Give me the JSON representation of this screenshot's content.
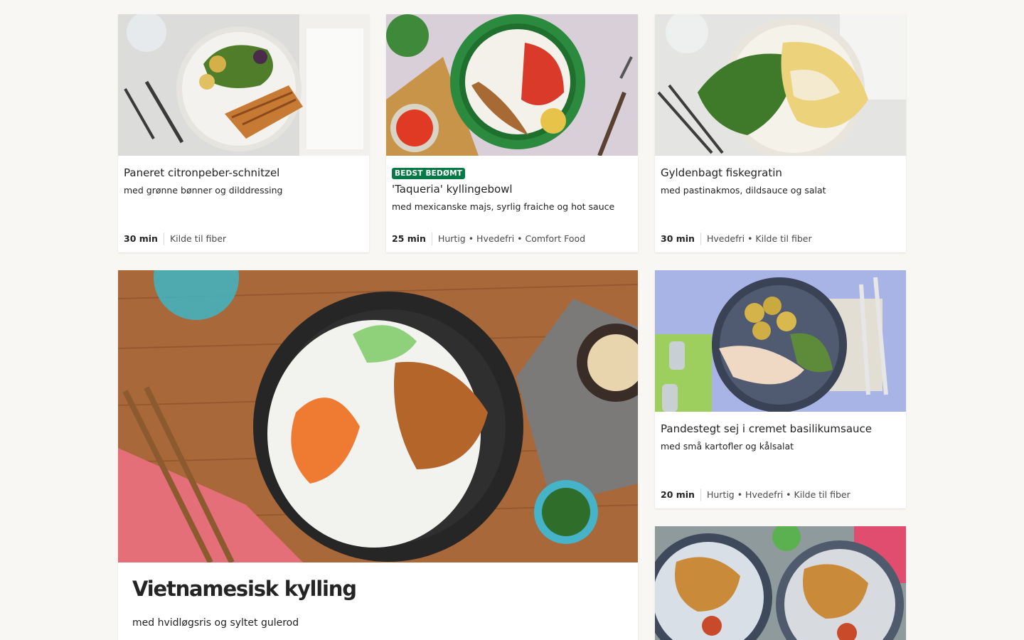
{
  "recipes": [
    {
      "title": "Paneret citronpeber-schnitzel",
      "subtitle": "med grønne bønner og dilddressing",
      "time": "30 min",
      "tags": "Kilde til fiber",
      "image": "schnitzel-plate-photo"
    },
    {
      "badge": "BEDST BEDØMT",
      "title": "'Taqueria' kyllingebowl",
      "subtitle": "med mexicanske majs, syrlig fraiche og hot sauce",
      "time": "25 min",
      "tags": "Hurtig • Hvedefri • Comfort Food",
      "image": "chicken-bowl-photo"
    },
    {
      "title": "Gyldenbagt fiskegratin",
      "subtitle": "med pastinakmos, dildsauce og salat",
      "time": "30 min",
      "tags": "Hvedefri • Kilde til fiber",
      "image": "fish-gratin-photo"
    },
    {
      "title": "Pandestegt sej i cremet basilikumsauce",
      "subtitle": "med små kartofler og kålsalat",
      "time": "20 min",
      "tags": "Hurtig • Hvedefri • Kilde til fiber",
      "image": "pan-fried-fish-photo"
    },
    {
      "image": "breaded-fish-plates-photo"
    }
  ],
  "featured": {
    "title": "Vietnamesisk kylling",
    "subtitle": "med hvidløgsris og syltet gulerod",
    "image": "vietnamese-chicken-bowl-photo"
  },
  "colors": {
    "page_background": "#f8f7f4",
    "card_background": "#ffffff",
    "badge_background": "#067a46",
    "text": "#242424"
  }
}
